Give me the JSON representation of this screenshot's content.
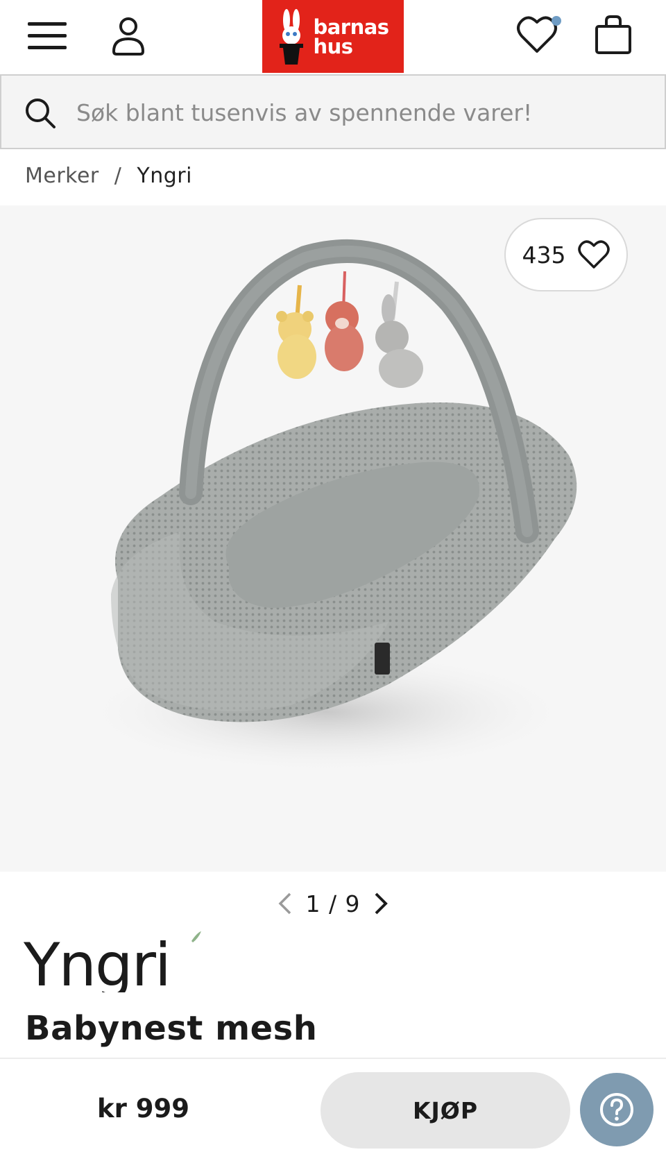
{
  "header": {
    "menu_icon": "hamburger-menu-icon",
    "account_icon": "user-account-icon",
    "wishlist_icon": "heart-icon",
    "cart_icon": "shopping-bag-icon",
    "logo": {
      "line1": "barnas",
      "line2": "hus",
      "background": "#e2231a"
    },
    "wishlist_dot_color": "#6f9cc4"
  },
  "search": {
    "icon": "search-icon",
    "placeholder": "Søk blant tusenvis av spennende varer!"
  },
  "breadcrumb": {
    "items": [
      "Merker",
      "Yngri"
    ],
    "separator": "/"
  },
  "gallery": {
    "like_count": "435",
    "like_icon": "heart-outline-icon",
    "current": 1,
    "total": 9,
    "pager_label": "1 / 9"
  },
  "product": {
    "brand": "Yngri",
    "title": "Babynest mesh",
    "price": "kr 999"
  },
  "actions": {
    "buy_label": "KJØP",
    "help_icon": "question-mark-icon",
    "help_color": "#7f9bb0"
  }
}
